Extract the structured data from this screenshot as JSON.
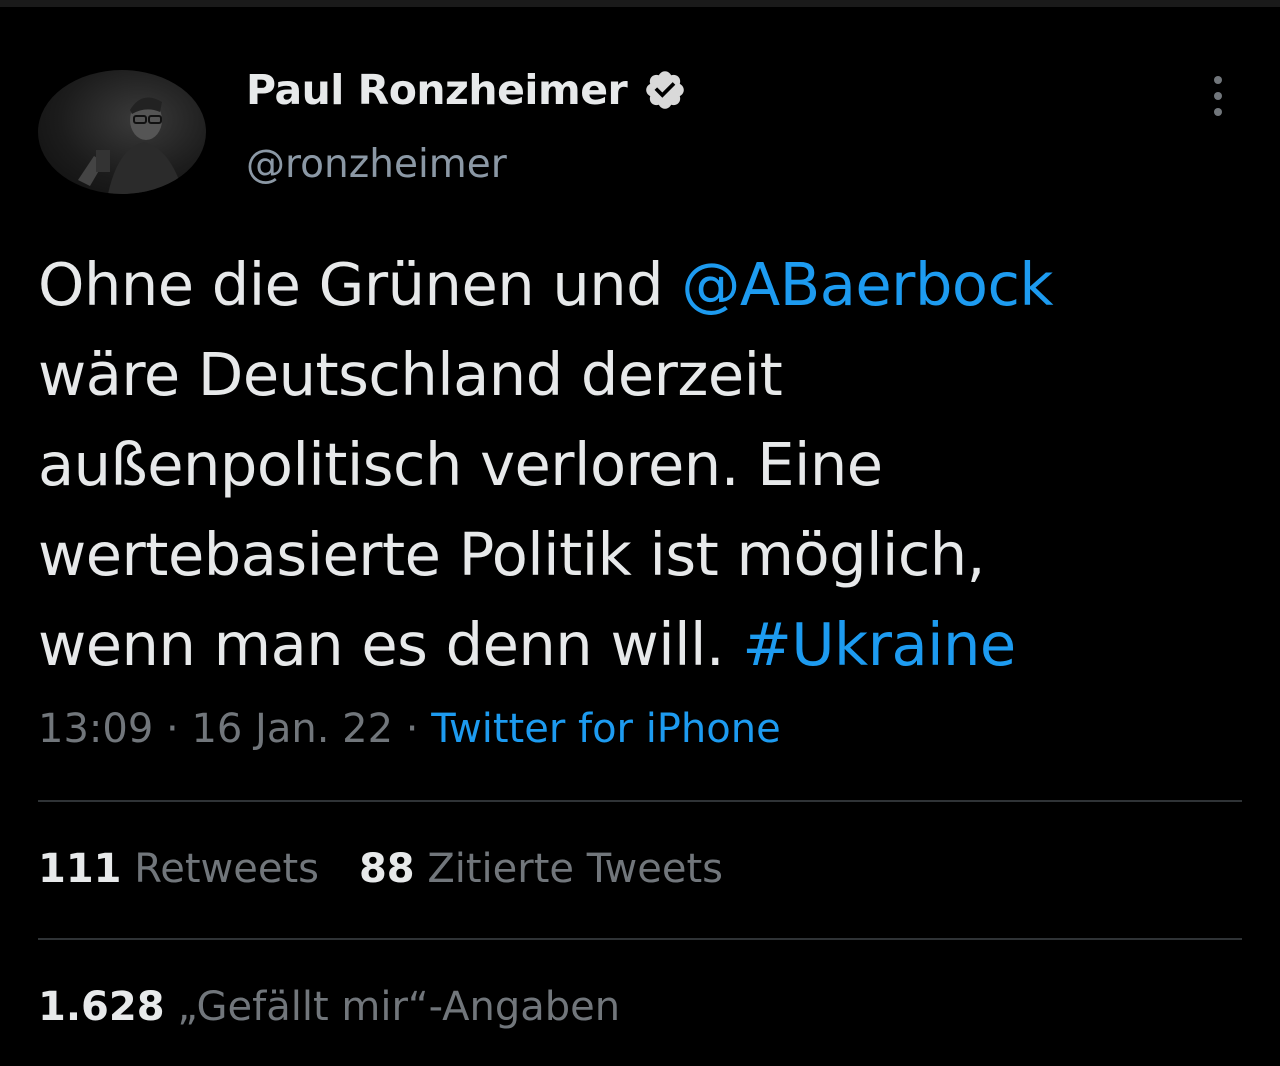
{
  "author": {
    "display_name": "Paul Ronzheimer",
    "handle": "@ronzheimer",
    "verified_icon": "verified-badge-icon"
  },
  "tweet": {
    "lines": [
      {
        "parts": [
          {
            "text": "Ohne die Grünen und ",
            "link": false
          },
          {
            "text": "@ABaerbock",
            "link": true
          }
        ]
      },
      {
        "parts": [
          {
            "text": "wäre Deutschland derzeit",
            "link": false
          }
        ]
      },
      {
        "parts": [
          {
            "text": "außenpolitisch verloren. Eine",
            "link": false
          }
        ]
      },
      {
        "parts": [
          {
            "text": "wertebasierte Politik ist möglich,",
            "link": false
          }
        ]
      },
      {
        "parts": [
          {
            "text": "wenn man es denn will. ",
            "link": false
          },
          {
            "text": "#Ukraine",
            "link": true
          }
        ]
      }
    ]
  },
  "meta": {
    "time": "13:09",
    "separator": "·",
    "date": "16 Jan. 22",
    "source": "Twitter for iPhone"
  },
  "stats": {
    "retweets_count": "111",
    "retweets_label": "Retweets",
    "quotes_count": "88",
    "quotes_label": "Zitierte Tweets",
    "likes_count": "1.628",
    "likes_label": "„Gefällt mir“-Angaben"
  },
  "colors": {
    "background": "#000000",
    "text": "#e7e9ea",
    "secondary": "#71767b",
    "accent": "#1d9bf0",
    "divider": "#2f3336"
  }
}
